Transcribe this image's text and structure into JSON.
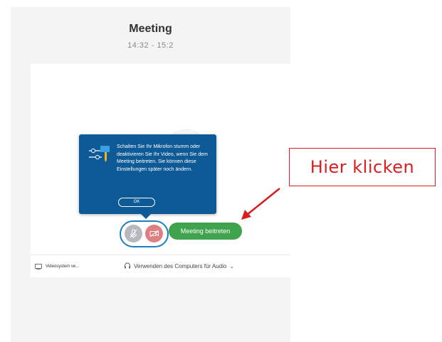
{
  "meeting": {
    "title": "Meeting",
    "time": "14:32 - 15:2"
  },
  "tooltip": {
    "message": "Schalten Sie Ihr Mikrofon stumm oder deaktivieren Sie Ihr Video, wenn Sie dem Meeting beitreten. Sie können diese Einstellungen später noch ändern.",
    "ok_label": "OK",
    "icon": "settings-sliders-icon",
    "color": "#0d5a96"
  },
  "controls": {
    "mic_icon": "mic-muted-icon",
    "video_icon": "video-off-icon",
    "join_label": "Meeting beitreten",
    "join_color": "#3fa34d",
    "mute_color": "#b5b9bd",
    "video_color": "#e07f82"
  },
  "footer": {
    "video_system_label": "Videosystem ve...",
    "audio_label": "Verwenden des Computers für Audio",
    "audio_chevron": "⌄"
  },
  "annotation": {
    "text": "Hier klicken",
    "color": "#d81e1e"
  }
}
